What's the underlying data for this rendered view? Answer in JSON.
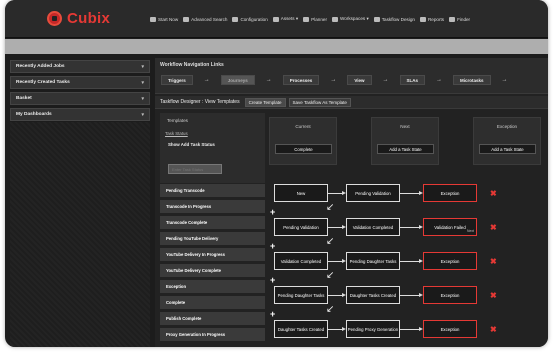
{
  "app": {
    "name": "Cubix"
  },
  "topnav": [
    {
      "icon": "dashboard-icon",
      "label": "Start Now"
    },
    {
      "icon": "search-icon",
      "label": "Advanced Search"
    },
    {
      "icon": "wrench-icon",
      "label": "Configuration"
    },
    {
      "icon": "assets-icon",
      "label": "Assets ▾"
    },
    {
      "icon": "planner-icon",
      "label": "Planner"
    },
    {
      "icon": "workspaces-icon",
      "label": "Workspaces ▾"
    },
    {
      "icon": "taskflow-icon",
      "label": "Taskflow Design"
    },
    {
      "icon": "reports-icon",
      "label": "Reports"
    },
    {
      "icon": "finder-icon",
      "label": "Finder"
    }
  ],
  "left_panels": [
    {
      "label": "Recently Added Jobs"
    },
    {
      "label": "Recently Created Tasks"
    },
    {
      "label": "Basket"
    },
    {
      "label": "My Dashboards"
    }
  ],
  "workflow_links": {
    "title": "Workflow Navigation Links",
    "steps": [
      "Triggers",
      "Journeys",
      "Processes",
      "View",
      "SLAs",
      "Microtasks"
    ]
  },
  "designer": {
    "title": "Taskflow Designer : View Templates",
    "tabs": [
      "Create Template",
      "Save Taskflow As Template"
    ]
  },
  "templates": {
    "heading": "Templates",
    "link": "Task Status",
    "show_label": "Show Add Task Status",
    "input_placeholder": "Enter Task Status"
  },
  "columns": [
    {
      "header": "Current",
      "button": "Complete"
    },
    {
      "header": "Next",
      "button": "Add a Task State"
    },
    {
      "header": "Exception",
      "button": "Add a Task State"
    }
  ],
  "status_list": [
    "Pending Transcode",
    "Transcode In Progress",
    "Transcode Complete",
    "Pending YouTube Delivery",
    "YouTube Delivery In Progress",
    "YouTube Delivery Complete",
    "Exception",
    "Complete",
    "Publish Complete",
    "Proxy Generation In Progress"
  ],
  "flow_rows": [
    {
      "current": "New",
      "next": "Pending Validation",
      "exception": "Exception",
      "exception_tag": ""
    },
    {
      "current": "Pending Validation",
      "next": "Validation Completed",
      "exception": "Validation Failed",
      "exception_tag": "Next"
    },
    {
      "current": "Validation Completed",
      "next": "Pending Daughter Tasks",
      "exception": "Exception",
      "exception_tag": ""
    },
    {
      "current": "Pending Daughter Tasks",
      "next": "Daughter Tasks Created",
      "exception": "Exception",
      "exception_tag": ""
    },
    {
      "current": "Daughter Tasks Created",
      "next": "Pending Proxy Generation",
      "exception": "Exception",
      "exception_tag": ""
    }
  ]
}
